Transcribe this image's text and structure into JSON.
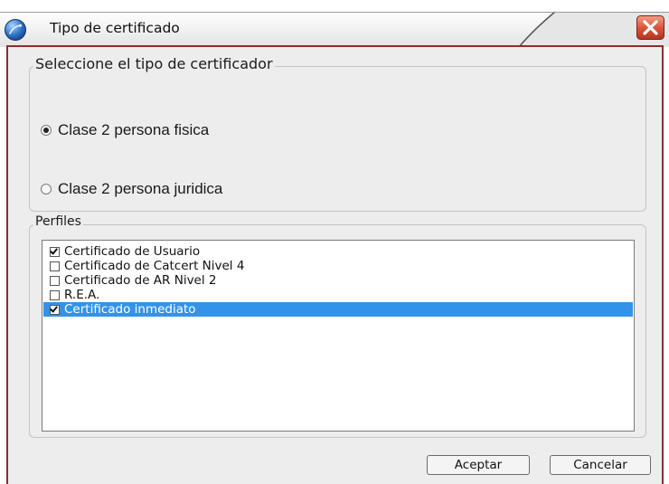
{
  "window": {
    "title": "Tipo de certificado",
    "title_icon": "app-globe-icon",
    "close_icon": "close-icon",
    "border_color": "#8e2d2d"
  },
  "certificate_type": {
    "legend": "Seleccione el tipo de certificador",
    "options": [
      {
        "label": "Clase 2 persona fisica",
        "selected": true
      },
      {
        "label": "Clase 2 persona juridica",
        "selected": false
      }
    ]
  },
  "profiles": {
    "legend": "Perfiles",
    "items": [
      {
        "label": "Certificado de Usuario",
        "checked": true,
        "highlighted": false
      },
      {
        "label": "Certificado de Catcert Nivel 4",
        "checked": false,
        "highlighted": false
      },
      {
        "label": "Certificado de AR Nivel 2",
        "checked": false,
        "highlighted": false
      },
      {
        "label": "R.E.A.",
        "checked": false,
        "highlighted": false
      },
      {
        "label": "Certificado inmediato",
        "checked": true,
        "highlighted": true
      }
    ],
    "highlight_color": "#3393e8"
  },
  "buttons": {
    "accept_label": "Aceptar",
    "cancel_label": "Cancelar"
  }
}
